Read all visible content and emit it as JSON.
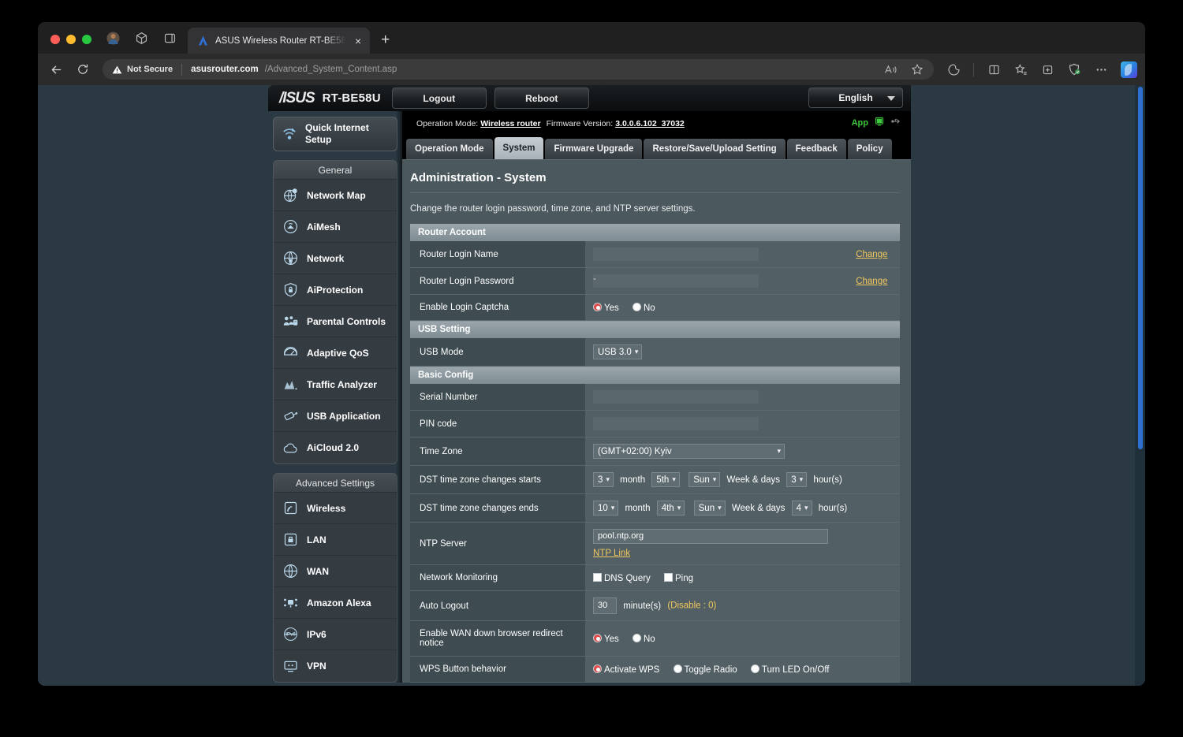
{
  "browser": {
    "tab": {
      "title": "ASUS Wireless Router RT-BE58",
      "close_label": "×",
      "favicon": "asus-logo-icon"
    },
    "new_tab_label": "+",
    "security_label": "Not Secure",
    "url_host": "asusrouter.com",
    "url_path": "/Advanced_System_Content.asp",
    "toolbar_icons": [
      "back-icon",
      "reload-icon",
      "read-aloud-icon",
      "favorite-icon",
      "browser-essentials-icon",
      "split-screen-icon",
      "favorites-list-icon",
      "collections-icon",
      "shield-check-icon",
      "settings-more-icon",
      "copilot-icon"
    ]
  },
  "router": {
    "brand": "/ISUS",
    "model": "RT-BE58U",
    "logout_label": "Logout",
    "reboot_label": "Reboot",
    "language": "English",
    "operation_mode_label": "Operation Mode:",
    "operation_mode_value": "Wireless router",
    "firmware_label": "Firmware Version:",
    "firmware_value": "3.0.0.6.102_37032",
    "app_label": "App",
    "quick_setup_label": "Quick Internet Setup",
    "tabs": [
      {
        "label": "Operation Mode",
        "active": false
      },
      {
        "label": "System",
        "active": true
      },
      {
        "label": "Firmware Upgrade",
        "active": false
      },
      {
        "label": "Restore/Save/Upload Setting",
        "active": false
      },
      {
        "label": "Feedback",
        "active": false
      },
      {
        "label": "Policy",
        "active": false
      }
    ],
    "menu": [
      {
        "header": "General",
        "items": [
          {
            "label": "Network Map",
            "icon": "network-map-icon"
          },
          {
            "label": "AiMesh",
            "icon": "aimesh-icon"
          },
          {
            "label": "Network",
            "icon": "network-icon"
          },
          {
            "label": "AiProtection",
            "icon": "shield-lock-icon"
          },
          {
            "label": "Parental Controls",
            "icon": "parental-controls-icon"
          },
          {
            "label": "Adaptive QoS",
            "icon": "gauge-icon"
          },
          {
            "label": "Traffic Analyzer",
            "icon": "traffic-analyzer-icon"
          },
          {
            "label": "USB Application",
            "icon": "usb-application-icon"
          },
          {
            "label": "AiCloud 2.0",
            "icon": "cloud-icon"
          }
        ]
      },
      {
        "header": "Advanced Settings",
        "items": [
          {
            "label": "Wireless",
            "icon": "wireless-icon"
          },
          {
            "label": "LAN",
            "icon": "lan-icon"
          },
          {
            "label": "WAN",
            "icon": "wan-globe-icon"
          },
          {
            "label": "Amazon Alexa",
            "icon": "amazon-alexa-icon"
          },
          {
            "label": "IPv6",
            "icon": "ipv6-icon"
          },
          {
            "label": "VPN",
            "icon": "vpn-icon"
          }
        ]
      }
    ],
    "page": {
      "title": "Administration - System",
      "description": "Change the router login password, time zone, and NTP server settings.",
      "sections": {
        "router_account": {
          "title": "Router Account",
          "login_name_label": "Router Login Name",
          "login_name_value": "",
          "login_name_change": "Change",
          "login_password_label": "Router Login Password",
          "login_password_value": "-",
          "login_password_change": "Change",
          "captcha_label": "Enable Login Captcha",
          "captcha_yes": "Yes",
          "captcha_no": "No",
          "captcha_selected": "Yes"
        },
        "usb_setting": {
          "title": "USB Setting",
          "usb_mode_label": "USB Mode",
          "usb_mode_value": "USB 3.0"
        },
        "basic_config": {
          "title": "Basic Config",
          "serial_number_label": "Serial Number",
          "serial_number_value": "",
          "pin_code_label": "PIN code",
          "pin_code_value": "",
          "time_zone_label": "Time Zone",
          "time_zone_value": "(GMT+02:00) Kyiv",
          "dst_start_label": "DST time zone changes starts",
          "dst_start_month": "3",
          "dst_start_week": "5th",
          "dst_start_day": "Sun",
          "dst_start_hour": "3",
          "dst_end_label": "DST time zone changes ends",
          "dst_end_month": "10",
          "dst_end_week": "4th",
          "dst_end_day": "Sun",
          "dst_end_hour": "4",
          "month_unit": "month",
          "weekdays_unit": "Week & days",
          "hours_unit": "hour(s)",
          "ntp_label": "NTP Server",
          "ntp_value": "pool.ntp.org",
          "ntp_link": "NTP Link",
          "network_monitoring_label": "Network Monitoring",
          "dns_query_label": "DNS Query",
          "dns_query_checked": false,
          "ping_label": "Ping",
          "ping_checked": false,
          "auto_logout_label": "Auto Logout",
          "auto_logout_value": "30",
          "auto_logout_unit": "minute(s)",
          "auto_logout_note": "(Disable : 0)",
          "wan_redirect_label": "Enable WAN down browser redirect notice",
          "wan_redirect_yes": "Yes",
          "wan_redirect_no": "No",
          "wan_redirect_selected": "Yes",
          "wps_label": "WPS Button behavior",
          "wps_opt1": "Activate WPS",
          "wps_opt2": "Toggle Radio",
          "wps_opt3": "Turn LED On/Off",
          "wps_selected": "Activate WPS"
        }
      }
    }
  },
  "colors": {
    "accent_link": "#f0c75e",
    "radio_on": "#e24b4b",
    "app_green": "#3ec93e",
    "scrollbar": "#2f6fd0"
  }
}
